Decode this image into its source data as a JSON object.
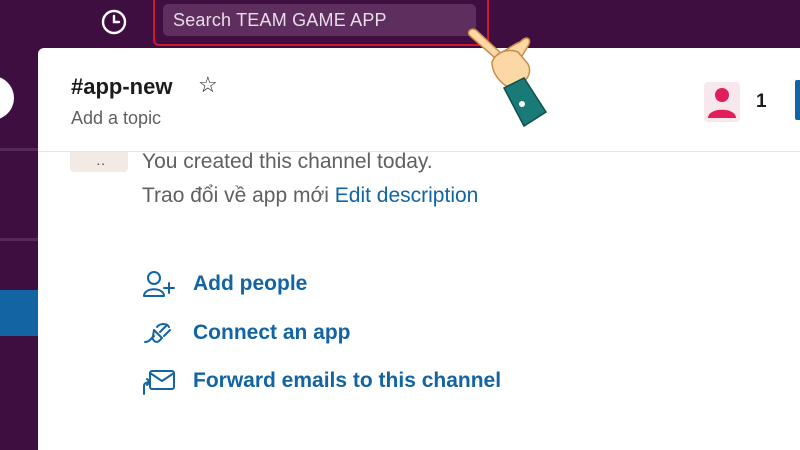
{
  "topbar": {
    "history_icon": "clock-icon",
    "search_placeholder": "Search TEAM GAME APP"
  },
  "channel": {
    "name": "#app-new",
    "star_icon": "star-outline-icon",
    "topic": "Add a topic",
    "member_icon": "person-icon",
    "member_count": "1"
  },
  "intro": {
    "created_text": "You created this channel today.",
    "description": "Trao đổi về app mới",
    "edit_description": "Edit description"
  },
  "actions": [
    {
      "label": "Add people",
      "icon": "add-person-icon"
    },
    {
      "label": "Connect an app",
      "icon": "plug-icon"
    },
    {
      "label": "Forward emails to this channel",
      "icon": "email-forward-icon"
    }
  ],
  "colors": {
    "sidebar": "#3f0e40",
    "search_bg": "#5d2e5e",
    "highlight": "#d3162f",
    "link": "#1264a3",
    "member_icon": "#e01e5a"
  },
  "overlay": {
    "cursor_icon": "hand-pointer-icon"
  }
}
